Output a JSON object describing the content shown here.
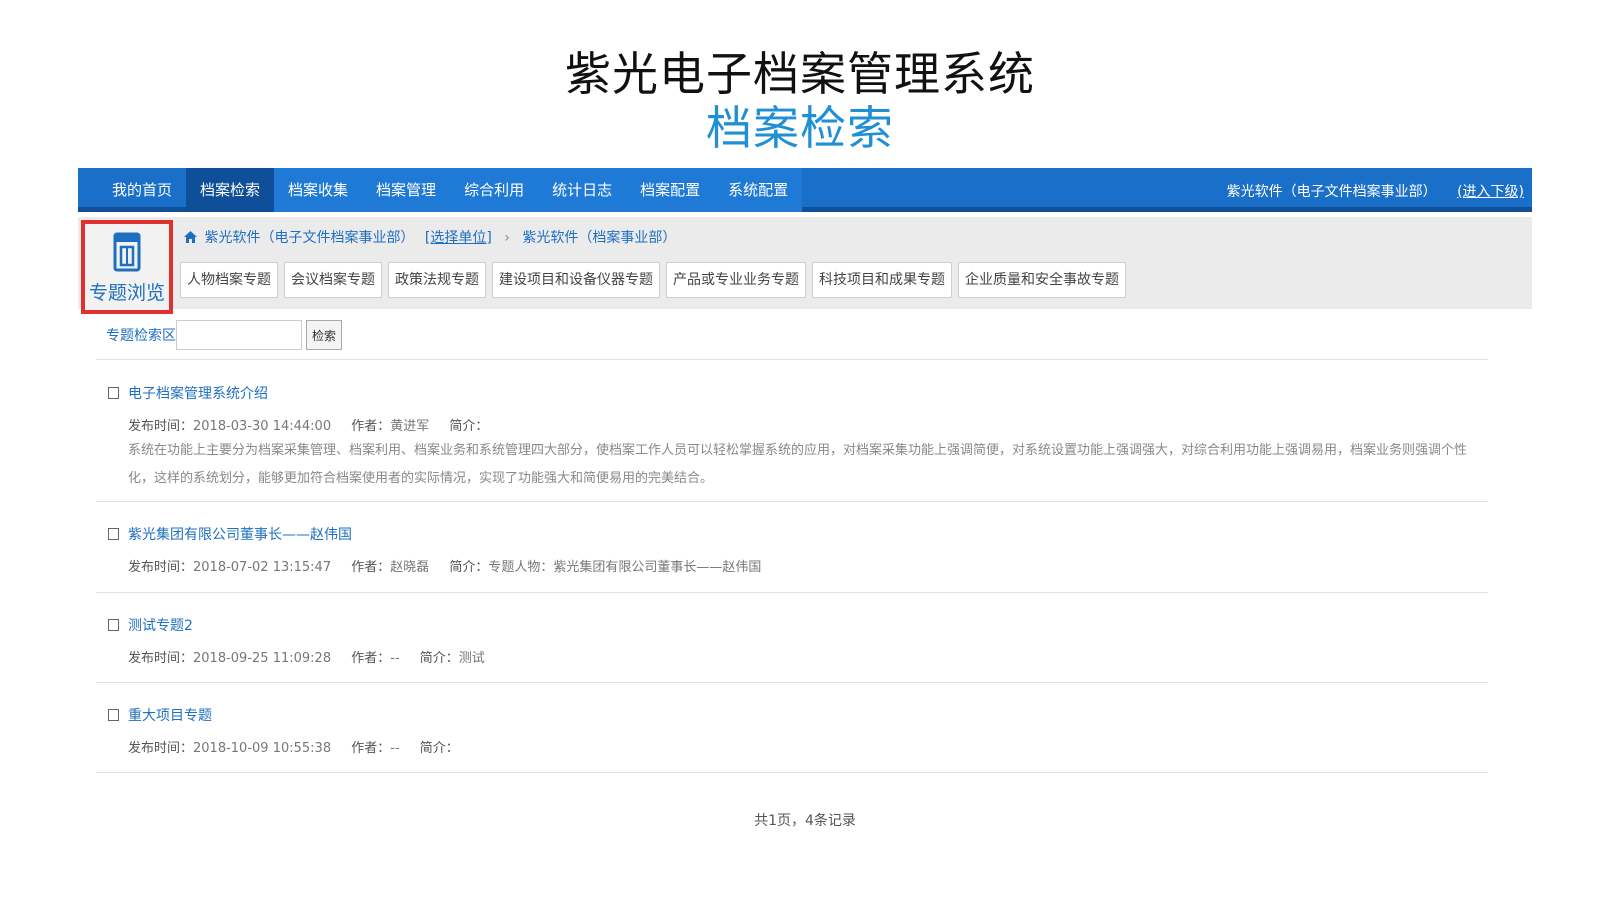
{
  "slide": {
    "title": "紫光电子档案管理系统",
    "subtitle": "档案检索"
  },
  "topnav": {
    "items": [
      {
        "label": "我的首页"
      },
      {
        "label": "档案检索"
      },
      {
        "label": "档案收集"
      },
      {
        "label": "档案管理"
      },
      {
        "label": "综合利用"
      },
      {
        "label": "统计日志"
      },
      {
        "label": "档案配置"
      },
      {
        "label": "系统配置"
      }
    ],
    "org": "紫光软件（电子文件档案事业部）",
    "enter_sub": "(进入下级)"
  },
  "special": {
    "label": "专题浏览",
    "icon": "book-icon"
  },
  "breadcrumb": {
    "org": "紫光软件（电子文件档案事业部）",
    "select_unit": "[选择单位]",
    "separator": "›",
    "current": "紫光软件（档案事业部）"
  },
  "topic_tabs": [
    {
      "label": "人物档案专题"
    },
    {
      "label": "会议档案专题"
    },
    {
      "label": "政策法规专题"
    },
    {
      "label": "建设项目和设备仪器专题"
    },
    {
      "label": "产品或专业业务专题"
    },
    {
      "label": "科技项目和成果专题"
    },
    {
      "label": "企业质量和安全事故专题"
    }
  ],
  "search": {
    "label": "专题检索区",
    "value": "",
    "button": "检索"
  },
  "labels": {
    "time": "发布时间：",
    "author": "作者：",
    "summary": "简介："
  },
  "records": [
    {
      "title": "电子档案管理系统介绍",
      "time": "2018-03-30 14:44:00",
      "author": "黄进军",
      "summary": "",
      "desc": "系统在功能上主要分为档案采集管理、档案利用、档案业务和系统管理四大部分，使档案工作人员可以轻松掌握系统的应用，对档案采集功能上强调简便，对系统设置功能上强调强大，对综合利用功能上强调易用，档案业务则强调个性化，这样的系统划分，能够更加符合档案使用者的实际情况，实现了功能强大和简便易用的完美结合。"
    },
    {
      "title": "紫光集团有限公司董事长——赵伟国",
      "time": "2018-07-02 13:15:47",
      "author": "赵晓磊",
      "summary": "专题人物：紫光集团有限公司董事长——赵伟国",
      "desc": ""
    },
    {
      "title": "测试专题2",
      "time": "2018-09-25 11:09:28",
      "author": "--",
      "summary": "测试",
      "desc": ""
    },
    {
      "title": "重大项目专题",
      "time": "2018-10-09 10:55:38",
      "author": "--",
      "summary": "",
      "desc": ""
    }
  ],
  "pager": {
    "text": "共1页，4条记录"
  },
  "colors": {
    "nav_bg": "#1a6fc9",
    "nav_active": "#0f4e98",
    "link": "#1f6fc0",
    "highlight_border": "#e03131",
    "subtitle": "#1f8fd6"
  }
}
